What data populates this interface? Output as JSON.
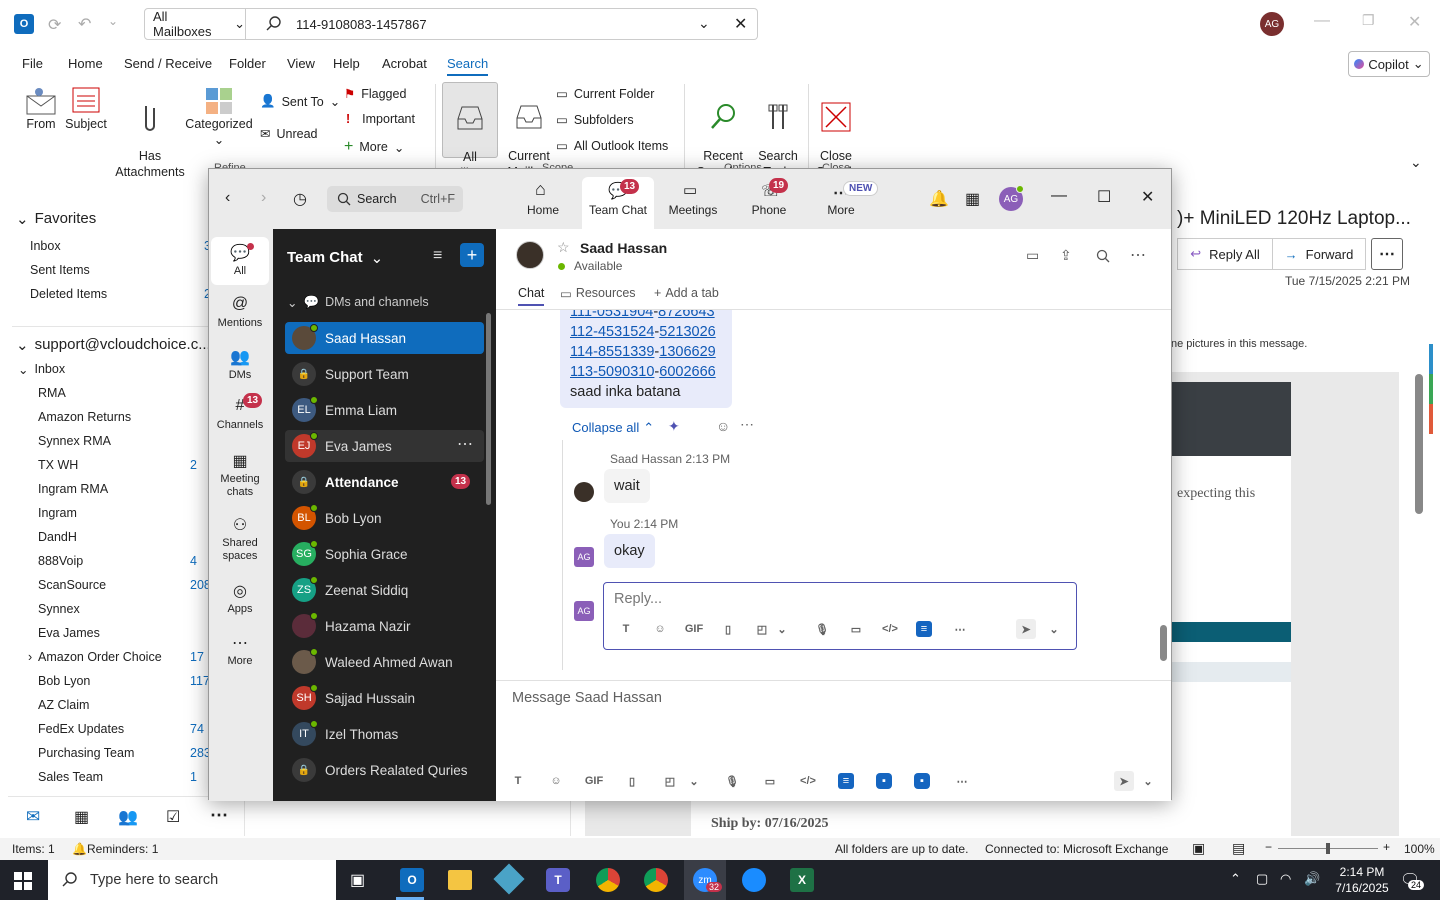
{
  "outlook": {
    "mailbox_scope": "All Mailboxes",
    "search_query": "114-9108083-1457867",
    "user_initials": "AG",
    "copilot_label": "Copilot",
    "menu": [
      "File",
      "Home",
      "Send / Receive",
      "Folder",
      "View",
      "Help",
      "Acrobat",
      "Search"
    ],
    "active_menu": "Search",
    "ribbon": {
      "from": "From",
      "subject": "Subject",
      "has_attachments": "Has\nAttachments",
      "categorized": "Categorized",
      "sent_to": "Sent To",
      "unread": "Unread",
      "flagged": "Flagged",
      "important": "Important",
      "more": "More",
      "all_mailboxes": "All\nMailboxes",
      "current_mailbox": "Current\nMailbox",
      "current_folder": "Current Folder",
      "subfolders": "Subfolders",
      "all_outlook_items": "All Outlook Items",
      "recent_searches": "Recent\nSearches",
      "search_tools": "Search\nTools",
      "close_search": "Close\nSearch",
      "group_refine": "Refine",
      "group_scope": "Scope",
      "group_options": "Options",
      "group_close": "Close"
    },
    "favorites_label": "Favorites",
    "favorites": [
      "Inbox",
      "Sent Items",
      "Deleted Items"
    ],
    "account": "support@vcloudchoice.c...",
    "inbox_label": "Inbox",
    "folders": [
      {
        "name": "RMA",
        "count": ""
      },
      {
        "name": "Amazon Returns",
        "count": ""
      },
      {
        "name": "Synnex RMA",
        "count": ""
      },
      {
        "name": "TX WH",
        "count": "2"
      },
      {
        "name": "Ingram RMA",
        "count": ""
      },
      {
        "name": "Ingram",
        "count": ""
      },
      {
        "name": "DandH",
        "count": ""
      },
      {
        "name": "888Voip",
        "count": "4"
      },
      {
        "name": "ScanSource",
        "count": "208"
      },
      {
        "name": "Synnex",
        "count": ""
      },
      {
        "name": "Eva James",
        "count": ""
      },
      {
        "name": "Amazon Order Choice",
        "count": "17"
      },
      {
        "name": "Bob Lyon",
        "count": "117"
      },
      {
        "name": "AZ Claim",
        "count": ""
      },
      {
        "name": "FedEx Updates",
        "count": "74"
      },
      {
        "name": "Purchasing Team",
        "count": "283"
      },
      {
        "name": "Sales Team",
        "count": "1"
      }
    ],
    "fav_counts": [
      "3",
      "",
      "2"
    ],
    "reading": {
      "subject_fragment": ")+ MiniLED 120Hz Laptop...",
      "reply_all": "Reply All",
      "forward": "Forward",
      "date": "Tue 7/15/2025 2:21 PM",
      "pictures_notice": "ne pictures in this message.",
      "expecting": "expecting this",
      "ship_by": "Ship by: 07/16/2025"
    },
    "status": {
      "items": "Items: 1",
      "reminders": "Reminders: 1",
      "folders_up_to_date": "All folders are up to date.",
      "connected": "Connected to: Microsoft Exchange",
      "zoom": "100%"
    }
  },
  "teams": {
    "search_placeholder": "Search",
    "search_shortcut": "Ctrl+F",
    "tabs": [
      {
        "label": "Home",
        "badge": ""
      },
      {
        "label": "Team Chat",
        "badge": "13"
      },
      {
        "label": "Meetings",
        "badge": ""
      },
      {
        "label": "Phone",
        "badge": "19"
      },
      {
        "label": "More",
        "badge": "NEW"
      }
    ],
    "user_initials": "AG",
    "rail": [
      {
        "label": "All",
        "badge": ""
      },
      {
        "label": "Mentions",
        "badge": ""
      },
      {
        "label": "DMs",
        "badge": ""
      },
      {
        "label": "Channels",
        "badge": "13"
      },
      {
        "label": "Meeting\nchats",
        "badge": ""
      },
      {
        "label": "Shared\nspaces",
        "badge": ""
      },
      {
        "label": "Apps",
        "badge": ""
      },
      {
        "label": "More",
        "badge": ""
      }
    ],
    "list_title": "Team Chat",
    "section": "DMs and channels",
    "chats": [
      {
        "name": "Saad Hassan",
        "initials": "",
        "color": "#5a4a3a",
        "active": true,
        "bold": false,
        "badge": ""
      },
      {
        "name": "Support Team",
        "initials": "",
        "color": "#3a3a3a",
        "active": false,
        "bold": false,
        "badge": ""
      },
      {
        "name": "Emma Liam",
        "initials": "EL",
        "color": "#3d5a80",
        "active": false,
        "bold": false,
        "badge": ""
      },
      {
        "name": "Eva James",
        "initials": "EJ",
        "color": "#c0392b",
        "active": false,
        "bold": false,
        "badge": ""
      },
      {
        "name": "Attendance",
        "initials": "",
        "color": "#3a3a3a",
        "active": false,
        "bold": true,
        "badge": "13"
      },
      {
        "name": "Bob Lyon",
        "initials": "BL",
        "color": "#d35400",
        "active": false,
        "bold": false,
        "badge": ""
      },
      {
        "name": "Sophia Grace",
        "initials": "SG",
        "color": "#27ae60",
        "active": false,
        "bold": false,
        "badge": ""
      },
      {
        "name": "Zeenat Siddiq",
        "initials": "ZS",
        "color": "#16a085",
        "active": false,
        "bold": false,
        "badge": ""
      },
      {
        "name": "Hazama Nazir",
        "initials": "",
        "color": "#5b2c3a",
        "active": false,
        "bold": false,
        "badge": ""
      },
      {
        "name": "Waleed Ahmed Awan",
        "initials": "",
        "color": "#6b5a4a",
        "active": false,
        "bold": false,
        "badge": ""
      },
      {
        "name": "Sajjad Hussain",
        "initials": "SH",
        "color": "#c0392b",
        "active": false,
        "bold": false,
        "badge": ""
      },
      {
        "name": "Izel Thomas",
        "initials": "IT",
        "color": "#34495e",
        "active": false,
        "bold": false,
        "badge": ""
      },
      {
        "name": "Orders Realated Quries",
        "initials": "",
        "color": "#3a3a3a",
        "active": false,
        "bold": false,
        "badge": ""
      }
    ],
    "contact_name": "Saad Hassan",
    "contact_status": "Available",
    "chat_tabs": [
      "Chat",
      "Resources",
      "Add a tab"
    ],
    "order_lines": [
      {
        "a": "111-0531904",
        "b": "8726643"
      },
      {
        "a": "112-4531524",
        "b": "5213026"
      },
      {
        "a": "114-8551339",
        "b": "1306629"
      },
      {
        "a": "113-5090310",
        "b": "6002666"
      }
    ],
    "order_note": "saad inka batana",
    "collapse_all": "Collapse all",
    "reply1_author": "Saad Hassan",
    "reply1_time": "2:13 PM",
    "reply1_text": "wait",
    "reply2_author": "You",
    "reply2_time": "2:14 PM",
    "reply2_text": "okay",
    "reply_placeholder": "Reply...",
    "message_placeholder": "Message Saad Hassan"
  },
  "taskbar": {
    "search_placeholder": "Type here to search",
    "time": "2:14 PM",
    "date": "7/16/2025",
    "notifications": "24",
    "zoom_badge": "32"
  }
}
